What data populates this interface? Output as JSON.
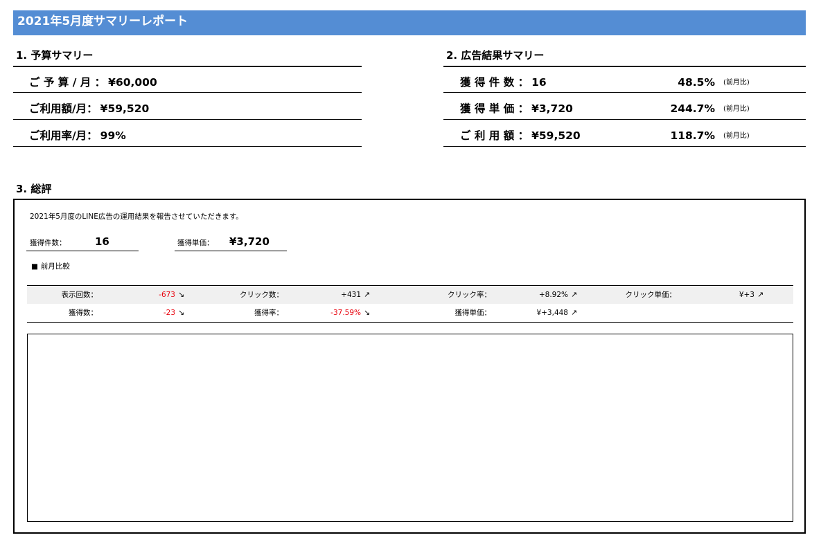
{
  "report_title": "2021年5月度サマリーレポート",
  "budget": {
    "heading": "1. 予算サマリー",
    "rows": [
      {
        "label": "ご 予 算 / 月 ：",
        "value": "¥60,000"
      },
      {
        "label": "ご利用額/月：",
        "value": "¥59,520"
      },
      {
        "label": "ご利用率/月：",
        "value": "99%"
      }
    ]
  },
  "ads": {
    "heading": "2. 広告結果サマリー",
    "rows": [
      {
        "label": "獲 得 件 数 ：",
        "value": "16",
        "pct": "48.5%",
        "note": "(前月比)"
      },
      {
        "label": "獲 得 単 価 ：",
        "value": "¥3,720",
        "pct": "244.7%",
        "note": "(前月比)"
      },
      {
        "label": "ご 利 用 額 ：",
        "value": "¥59,520",
        "pct": "118.7%",
        "note": "(前月比)"
      }
    ]
  },
  "review": {
    "heading": "3. 総評",
    "intro": "2021年5月度のLINE広告の運用結果を報告させていただきます。",
    "kpi": [
      {
        "label": "獲得件数：",
        "value": "16"
      },
      {
        "label": "獲得単価：",
        "value": "¥3,720"
      }
    ],
    "comparison_heading": "前月比較",
    "comparison_bullet": "■",
    "stats_row1": [
      {
        "label": "表示回数：",
        "value": "-673",
        "arrow": "↘",
        "negative": true
      },
      {
        "label": "クリック数：",
        "value": "+431",
        "arrow": "↗",
        "negative": false
      },
      {
        "label": "クリック率：",
        "value": "+8.92%",
        "arrow": "↗",
        "negative": false
      },
      {
        "label": "クリック単価：",
        "value": "¥+3",
        "arrow": "↗",
        "negative": false
      }
    ],
    "stats_row2": [
      {
        "label": "獲得数：",
        "value": "-23",
        "arrow": "↘",
        "negative": true
      },
      {
        "label": "獲得率：",
        "value": "-37.59%",
        "arrow": "↘",
        "negative": true
      },
      {
        "label": "獲得単価：",
        "value": "¥+3,448",
        "arrow": "↗",
        "negative": false
      }
    ]
  },
  "colors": {
    "title_bar": "#548dd4",
    "negative": "#e8000b",
    "row_shade": "#f0f0f0"
  }
}
